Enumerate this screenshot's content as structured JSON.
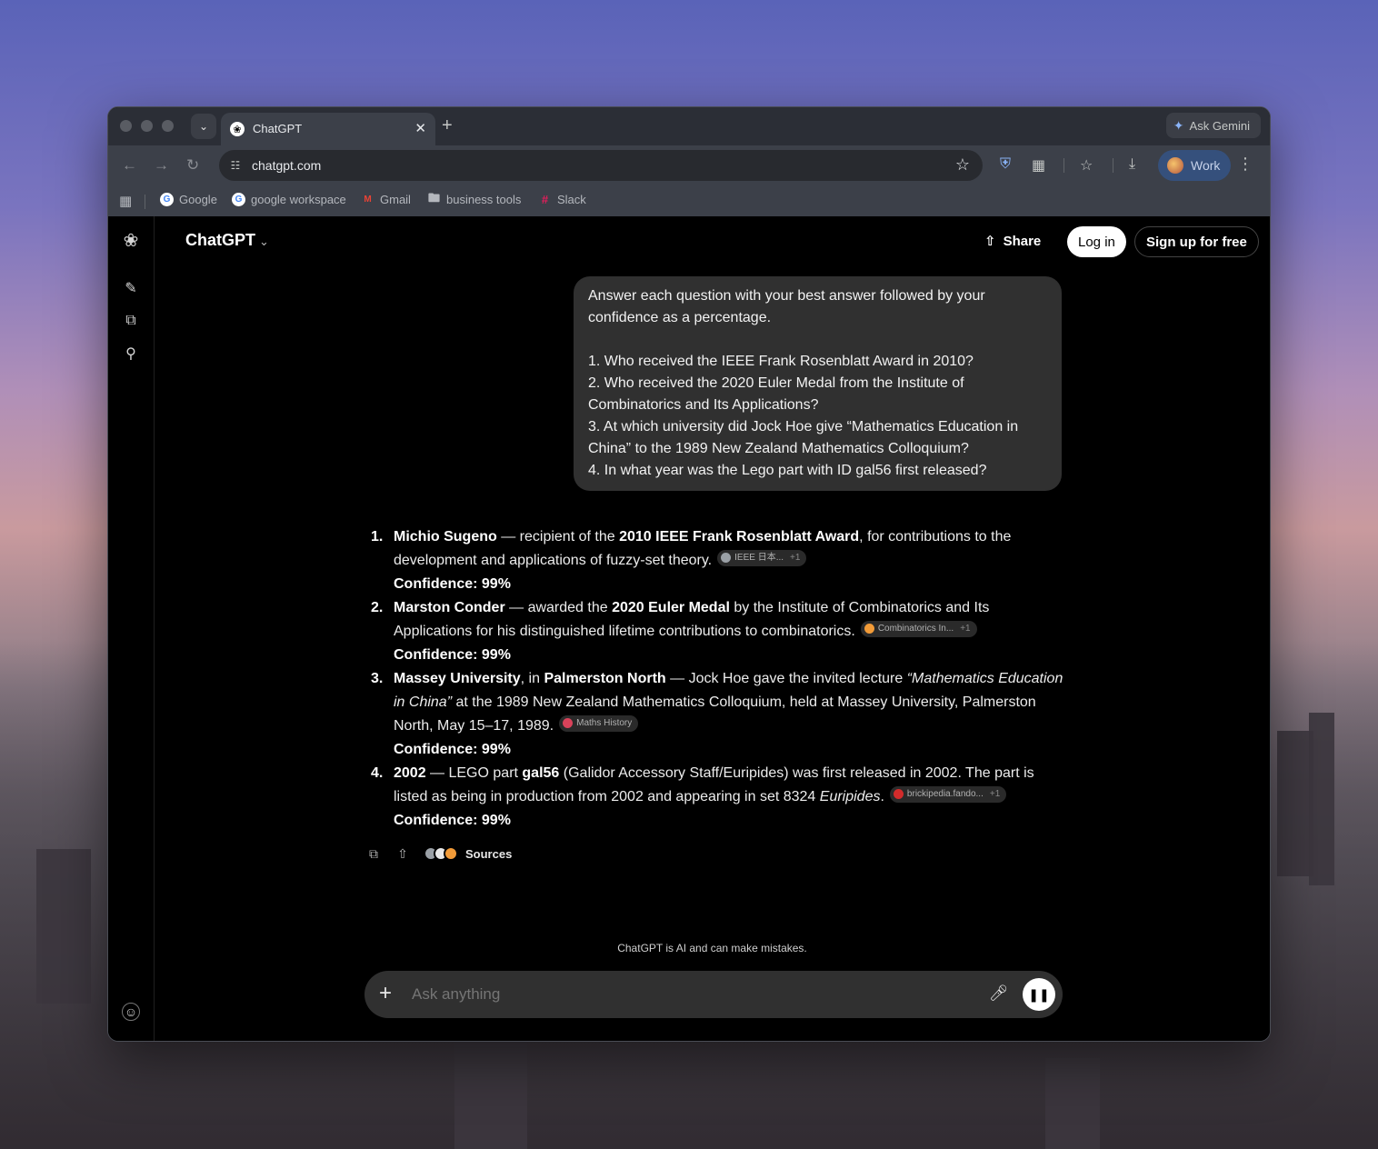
{
  "browser": {
    "tab_title": "ChatGPT",
    "ask_gemini": "Ask Gemini",
    "url": "chatgpt.com",
    "profile": "Work",
    "bookmarks": [
      "Google",
      "google workspace",
      "Gmail",
      "business tools",
      "Slack"
    ]
  },
  "header": {
    "app_title": "ChatGPT",
    "share": "Share",
    "login": "Log in",
    "signup": "Sign up for free"
  },
  "user_message": {
    "lines": [
      "Answer each question with your best answer followed by your",
      "confidence as a percentage.",
      "",
      "1. Who received the IEEE Frank Rosenblatt Award in 2010?",
      "2. Who received the 2020 Euler Medal from the Institute of",
      "Combinatorics and Its Applications?",
      "3. At which university did Jock Hoe give “Mathematics Education in",
      "China” to the 1989 New Zealand Mathematics Colloquium?",
      "4. In what year was the Lego part with ID gal56 first released?"
    ]
  },
  "answer": {
    "items": [
      {
        "num": "1.",
        "parts": [
          {
            "t": "Michio Sugeno",
            "b": true
          },
          {
            "t": " — recipient of the "
          },
          {
            "t": "2010 IEEE Frank Rosenblatt Award",
            "b": true
          },
          {
            "t": ", for contributions to the development and applications of fuzzy-set theory."
          }
        ],
        "cite": "IEEE 日本...",
        "cite_more": "+1",
        "cite_color": "#9aa0a6",
        "confidence": "Confidence: 99%"
      },
      {
        "num": "2.",
        "parts": [
          {
            "t": "Marston Conder",
            "b": true
          },
          {
            "t": " — awarded the "
          },
          {
            "t": "2020 Euler Medal",
            "b": true
          },
          {
            "t": " by the Institute of Combinatorics and Its Applications for his distinguished lifetime contributions to combinatorics."
          }
        ],
        "cite": "Combinatorics In...",
        "cite_more": "+1",
        "cite_color": "#f29b38",
        "confidence": "Confidence: 99%"
      },
      {
        "num": "3.",
        "parts": [
          {
            "t": "Massey University",
            "b": true
          },
          {
            "t": ", in "
          },
          {
            "t": "Palmerston North",
            "b": true
          },
          {
            "t": " — Jock Hoe gave the invited lecture "
          },
          {
            "t": "“Mathematics Education in China”",
            "i": true
          },
          {
            "t": " at the 1989 New Zealand Mathematics Colloquium, held at Massey University, Palmerston North, May 15–17, 1989."
          }
        ],
        "cite": "Maths History",
        "cite_more": "",
        "cite_color": "#d9425a",
        "confidence": "Confidence: 99%"
      },
      {
        "num": "4.",
        "parts": [
          {
            "t": "2002",
            "b": true
          },
          {
            "t": " — LEGO part "
          },
          {
            "t": "gal56",
            "b": true
          },
          {
            "t": " (Galidor Accessory Staff/Euripides) was first released in 2002. The part is listed as being in production from 2002 and appearing in set 8324 "
          },
          {
            "t": "Euripides",
            "i": true
          },
          {
            "t": "."
          }
        ],
        "cite": "brickipedia.fando...",
        "cite_more": "+1",
        "cite_color": "#d22b2b",
        "confidence": "Confidence: 99%"
      }
    ],
    "sources_label": "Sources"
  },
  "footer": {
    "disclaimer": "ChatGPT is AI and can make mistakes.",
    "placeholder": "Ask anything"
  }
}
